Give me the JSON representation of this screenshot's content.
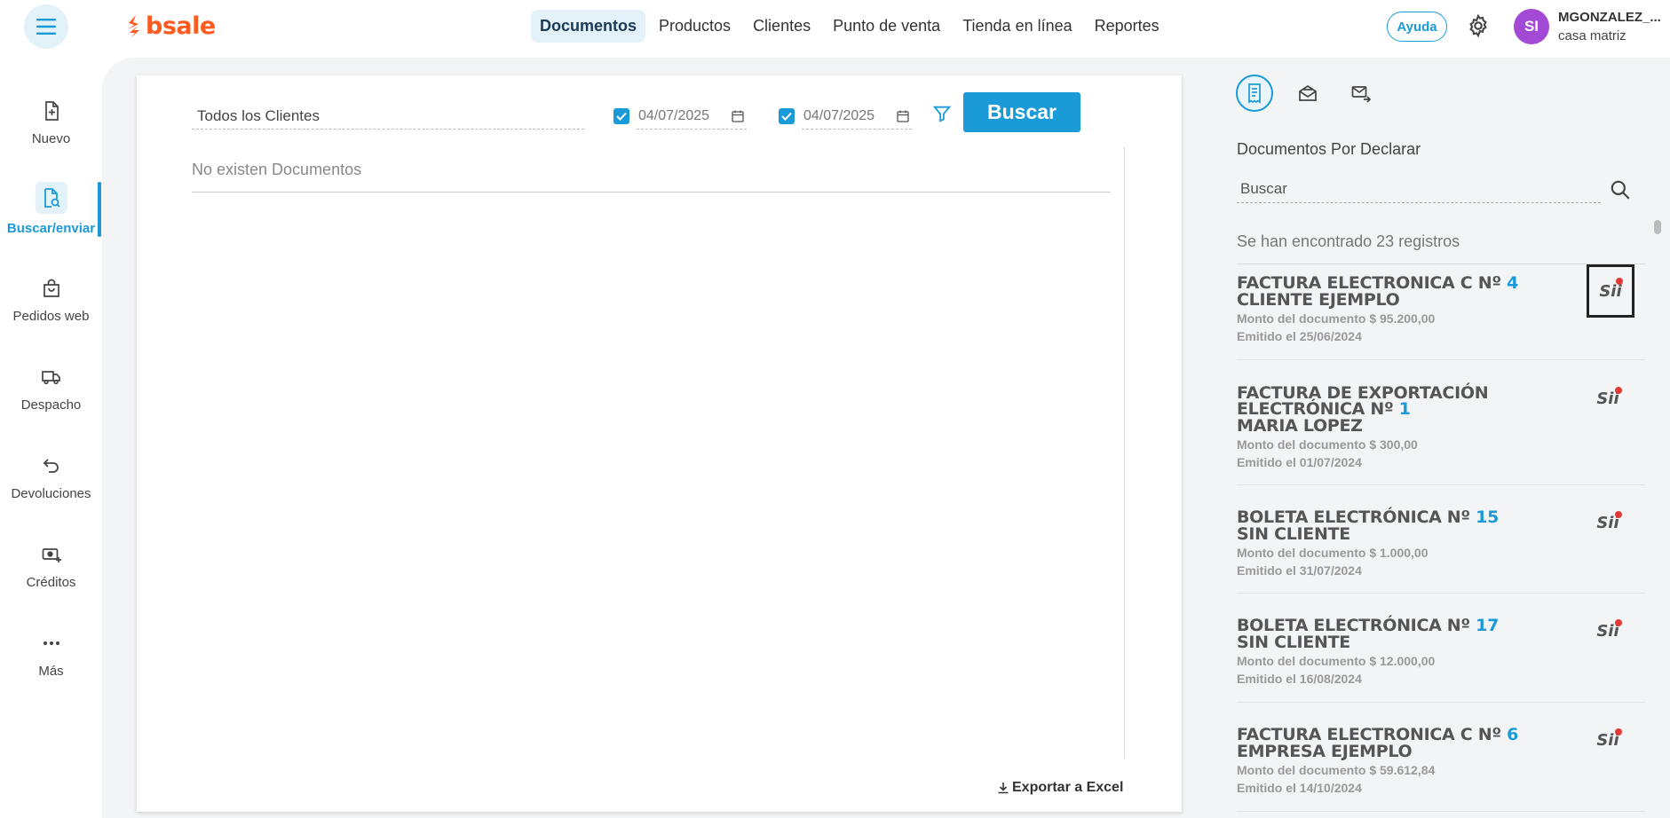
{
  "app": {
    "brand": "bsale"
  },
  "nav": {
    "items": [
      "Documentos",
      "Productos",
      "Clientes",
      "Punto de venta",
      "Tienda en línea",
      "Reportes"
    ],
    "active": "Documentos"
  },
  "header": {
    "help_label": "Ayuda",
    "avatar_initials": "SI",
    "user_name": "MGONZALEZ_...",
    "branch": "casa matriz"
  },
  "sidebar": {
    "items": [
      {
        "label": "Nuevo",
        "icon": "file-plus-icon"
      },
      {
        "label": "Buscar/enviar",
        "icon": "file-search-icon",
        "active": true
      },
      {
        "label": "Pedidos web",
        "icon": "shopping-bag-icon"
      },
      {
        "label": "Despacho",
        "icon": "truck-icon"
      },
      {
        "label": "Devoluciones",
        "icon": "return-arrow-icon"
      },
      {
        "label": "Créditos",
        "icon": "cash-plus-icon"
      },
      {
        "label": "Más",
        "icon": "more-dots-icon"
      }
    ]
  },
  "filters": {
    "client": "Todos los Clientes",
    "date_from": "04/07/2025",
    "date_to": "04/07/2025",
    "search_label": "Buscar"
  },
  "results": {
    "empty_message": "No existen Documentos",
    "export_label": "Exportar a Excel"
  },
  "panel": {
    "title": "Documentos Por Declarar",
    "search_placeholder": "Buscar",
    "count_text": "Se han encontrado 23 registros",
    "sii_label": "Sii",
    "documents": [
      {
        "type": "FACTURA ELECTRONICA C Nº",
        "number": "4",
        "client": "CLIENTE EJEMPLO",
        "amount": "Monto del documento $ 95.200,00",
        "issued": "Emitido el 25/06/2024"
      },
      {
        "type": "FACTURA DE EXPORTACIÓN ELECTRÓNICA Nº",
        "number": "1",
        "client": "MARIA LOPEZ",
        "amount": "Monto del documento $ 300,00",
        "issued": "Emitido el 01/07/2024"
      },
      {
        "type": "BOLETA ELECTRÓNICA Nº",
        "number": "15",
        "client": "SIN CLIENTE",
        "amount": "Monto del documento $ 1.000,00",
        "issued": "Emitido el 31/07/2024"
      },
      {
        "type": "BOLETA ELECTRÓNICA Nº",
        "number": "17",
        "client": "SIN CLIENTE",
        "amount": "Monto del documento $ 12.000,00",
        "issued": "Emitido el 16/08/2024"
      },
      {
        "type": "FACTURA ELECTRONICA C Nº",
        "number": "6",
        "client": "EMPRESA EJEMPLO",
        "amount": "Monto del documento $ 59.612,84",
        "issued": "Emitido el 14/10/2024"
      }
    ]
  },
  "colors": {
    "accent": "#1a9ad6",
    "brand": "#ff5a1f",
    "avatar": "#a24ad6",
    "badge_dot": "#e53935"
  }
}
